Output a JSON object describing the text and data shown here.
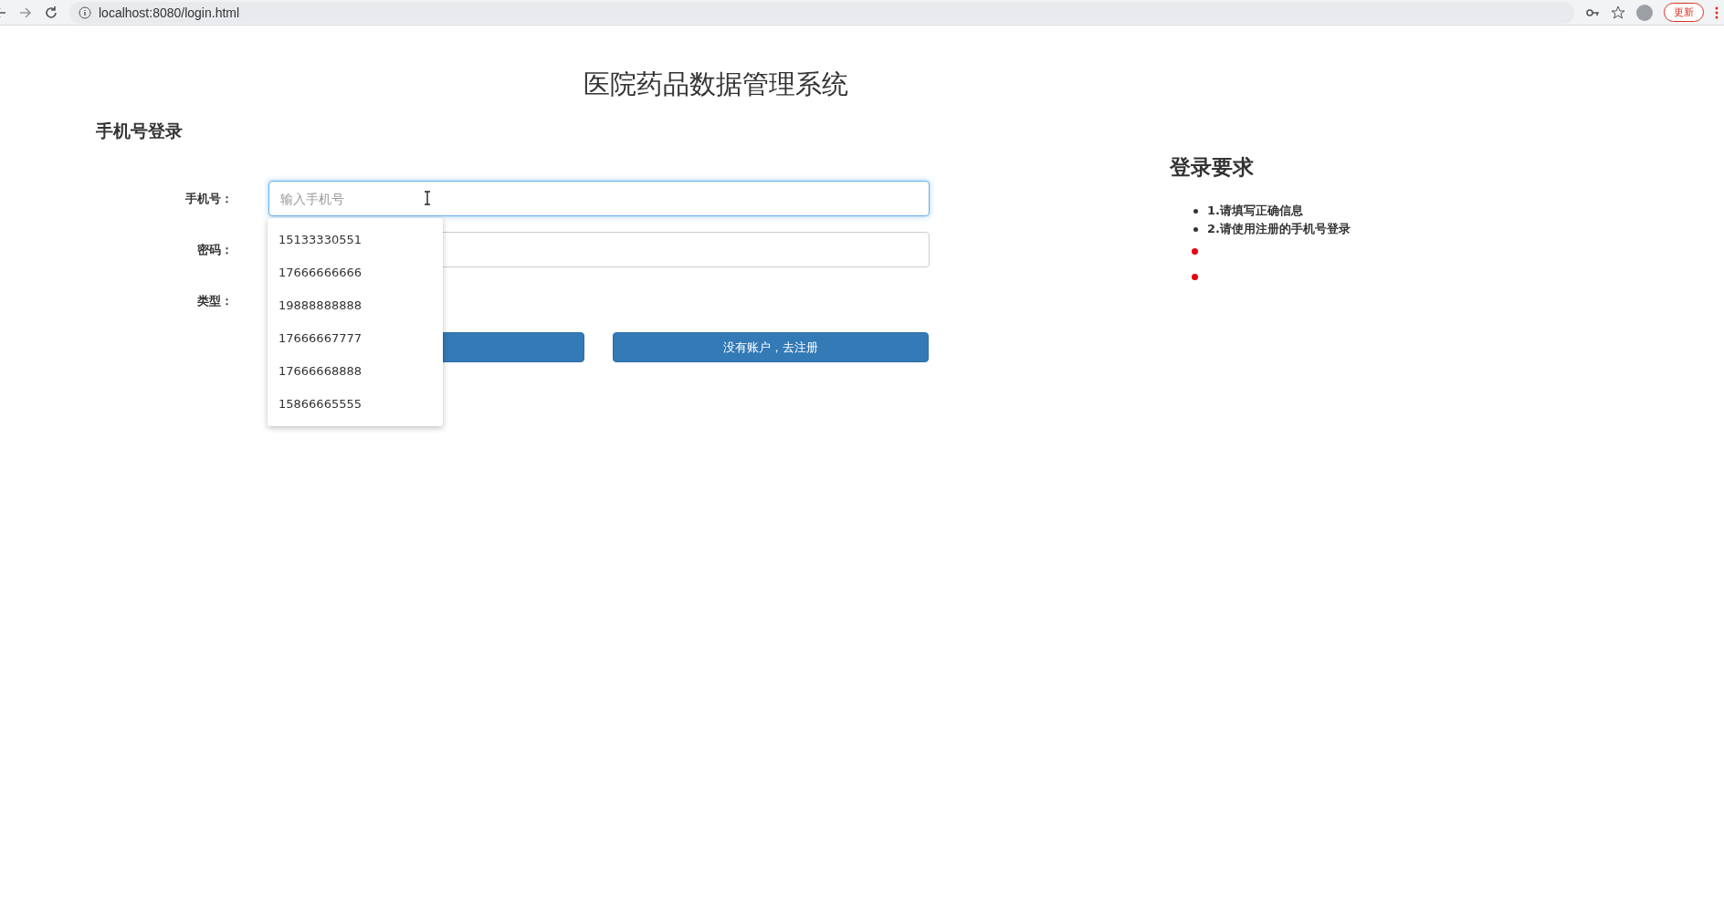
{
  "browser": {
    "url": "localhost:8080/login.html",
    "update_button": "更新"
  },
  "title": "医院药品数据管理系统",
  "login": {
    "heading": "手机号登录",
    "fields": [
      {
        "label": "手机号：",
        "kind": "text",
        "placeholder": "输入手机号",
        "focused": true
      },
      {
        "label": "密码：",
        "kind": "password",
        "focused": false
      },
      {
        "label": "类型：",
        "kind": "blank"
      }
    ],
    "autocomplete": [
      "15133330551",
      "17666666666",
      "19888888888",
      "17666667777",
      "17666668888",
      "15866665555"
    ],
    "buttons": [
      {
        "kind": "covered"
      },
      {
        "kind": "labeled",
        "label": "没有账户，去注册"
      }
    ]
  },
  "requirements": {
    "heading": "登录要求",
    "items": [
      {
        "text": "1.请填写正确信息",
        "color": "#333333"
      },
      {
        "text": "2.请使用注册的手机号登录",
        "color": "#333333"
      },
      {
        "color": "#e60012"
      },
      {
        "color": "#e60012"
      }
    ]
  }
}
